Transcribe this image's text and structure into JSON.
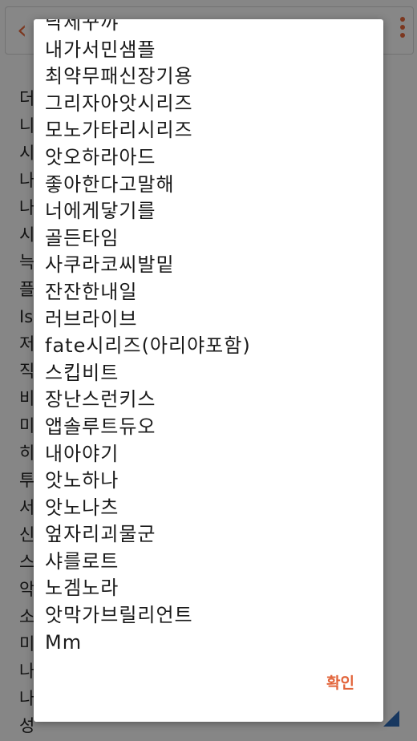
{
  "background": {
    "visible_lines": [
      "더",
      "니",
      "시",
      "나",
      "나",
      "시",
      "늑",
      "플",
      "Is",
      "저",
      "직",
      "비",
      "미",
      "히",
      "투",
      "서",
      "신",
      "스",
      "악",
      "소",
      "미",
      "나",
      "나",
      "성"
    ]
  },
  "dialog": {
    "items": [
      "낙제꾸꺄",
      "내가서민샘플",
      "최약무패신장기용",
      "그리자아앗시리즈",
      "모노가타리시리즈",
      "앗오하라아드",
      "좋아한다고말해",
      "너에게닿기를",
      "골든타임",
      "사쿠라코씨발밑",
      "잔잔한내일",
      "러브라이브",
      "fate시리즈(아리야포함)",
      "스킵비트",
      "장난스런키스",
      "앱솔루트듀오",
      "내아야기",
      "앗노하나",
      "앗노나츠",
      "엎자리괴물군",
      "샤를로트",
      "노겜노라",
      "앗막가브릴리언트",
      "Mm"
    ],
    "confirm_label": "확인"
  },
  "colors": {
    "accent": "#e2643a",
    "corner": "#2c67b0"
  }
}
